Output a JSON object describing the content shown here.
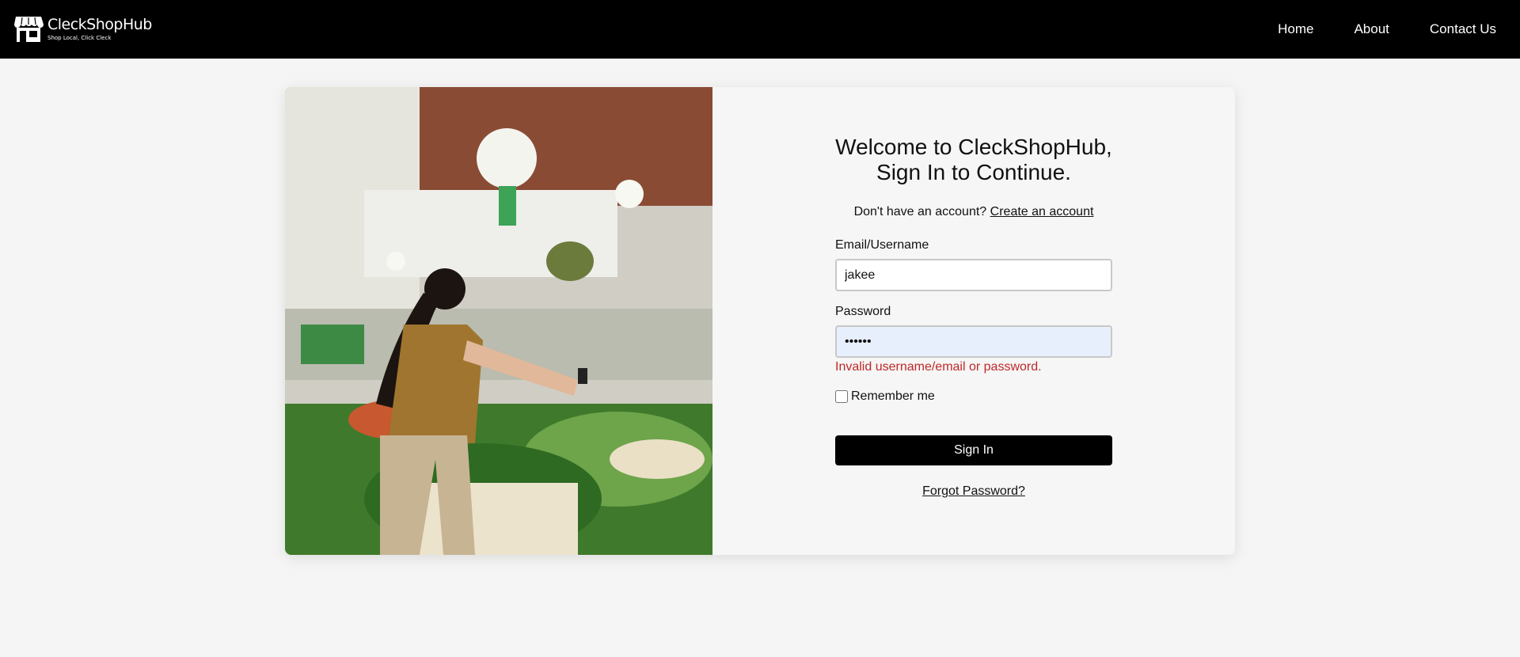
{
  "header": {
    "brand_name": "CleckShopHub",
    "brand_tagline": "Shop Local, Click Cleck",
    "nav": [
      "Home",
      "About",
      "Contact Us"
    ]
  },
  "login": {
    "title_line1": "Welcome to CleckShopHub,",
    "title_line2": "Sign In to Continue.",
    "no_account_text": "Don't have an account?",
    "create_account_link": "Create an account",
    "email_label": "Email/Username",
    "email_value": "jakee",
    "password_label": "Password",
    "password_value": "••••••",
    "error_message": "Invalid username/email or password.",
    "remember_label": "Remember me",
    "remember_checked": false,
    "signin_button": "Sign In",
    "forgot_link": "Forgot Password?"
  },
  "colors": {
    "header_bg": "#000000",
    "button_bg": "#000000",
    "error": "#c0282a",
    "page_bg": "#f4f5f4"
  },
  "icons": [
    "storefront-icon"
  ]
}
